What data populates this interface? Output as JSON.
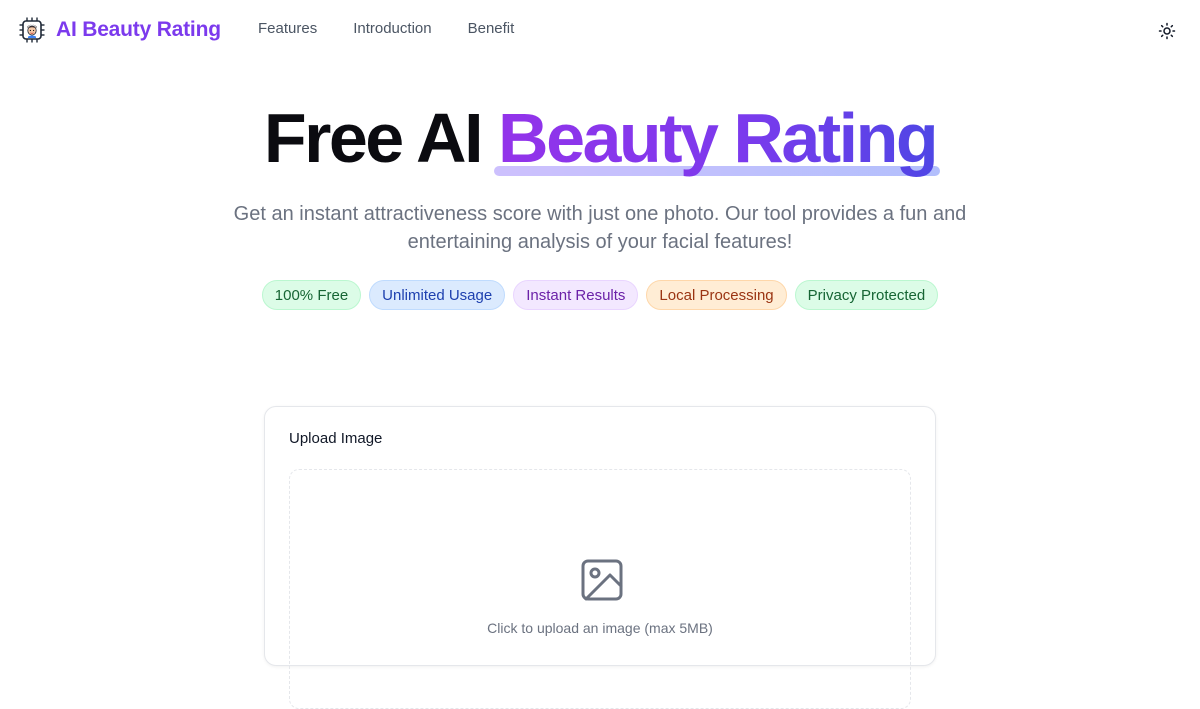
{
  "header": {
    "brand_name": "AI Beauty Rating",
    "brand_icon": "robot-face-chip-icon",
    "nav": [
      {
        "label": "Features"
      },
      {
        "label": "Introduction"
      },
      {
        "label": "Benefit"
      }
    ],
    "theme_icon": "sun-icon"
  },
  "hero": {
    "title_plain": "Free AI ",
    "title_highlight": "Beauty Rating",
    "subtitle": "Get an instant attractiveness score with just one photo. Our tool provides a fun and entertaining analysis of your facial features!",
    "badges": [
      {
        "label": "100% Free",
        "bg": "#dcfce7",
        "border": "#bbf7d0",
        "color": "#166534"
      },
      {
        "label": "Unlimited Usage",
        "bg": "#dbeafe",
        "border": "#bfdbfe",
        "color": "#1e40af"
      },
      {
        "label": "Instant Results",
        "bg": "#f3e8ff",
        "border": "#e9d5ff",
        "color": "#6b21a8"
      },
      {
        "label": "Local Processing",
        "bg": "#ffedd5",
        "border": "#fed7aa",
        "color": "#9a3412"
      },
      {
        "label": "Privacy Protected",
        "bg": "#dcfce7",
        "border": "#bbf7d0",
        "color": "#166534"
      }
    ]
  },
  "upload": {
    "title": "Upload Image",
    "icon": "image-icon",
    "hint": "Click to upload an image (max 5MB)"
  },
  "colors": {
    "brand": "#7c3aed",
    "gradient_start": "#9333ea",
    "gradient_end": "#4f46e5"
  }
}
